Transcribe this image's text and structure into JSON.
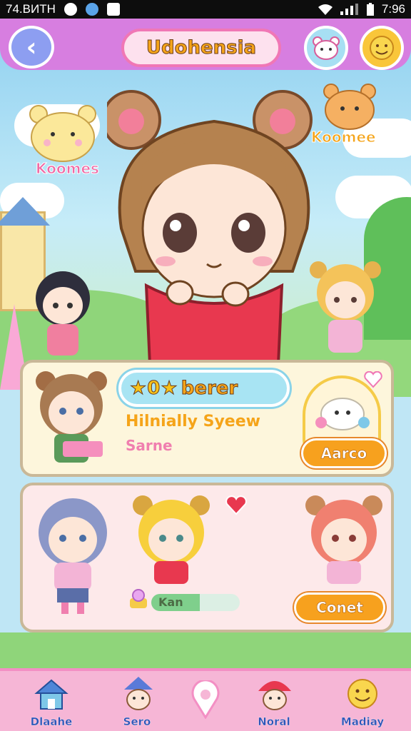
{
  "status_bar": {
    "carrier": "74.ВИТН",
    "time": "7:96"
  },
  "header": {
    "title": "Udohensia"
  },
  "scene": {
    "tag_left": "Koomes",
    "tag_right": "Koomee"
  },
  "panel1": {
    "stars": "★0★",
    "name": "berer",
    "subtitle": "Hilnially Syeew",
    "subtitle2": "Sarne",
    "action_label": "Aarco"
  },
  "panel2": {
    "progress_label": "Kan",
    "progress": 0.55,
    "action_label": "Conet"
  },
  "bottom_nav": {
    "items": [
      {
        "label": "Dlaahe"
      },
      {
        "label": "Sero"
      },
      {
        "label": "Noral"
      },
      {
        "label": "Madiay"
      }
    ]
  },
  "colors": {
    "accent": "#d77ee0",
    "pink": "#f38fc4",
    "orange": "#f7a11e"
  }
}
